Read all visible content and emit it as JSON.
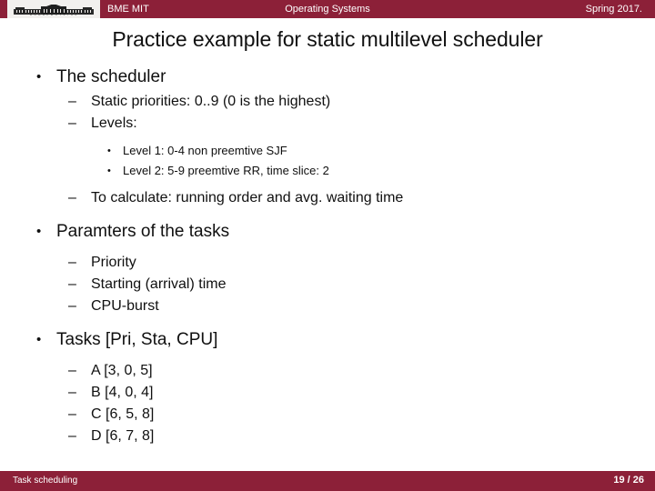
{
  "header": {
    "logo_caption": "B U D A P E S T  1 7 8 2",
    "logo_icon": "bme-building-icon",
    "left_label": "BME MIT",
    "center_label": "Operating Systems",
    "right_label": "Spring 2017."
  },
  "title": "Practice example for static multilevel scheduler",
  "content": {
    "scheduler": {
      "heading": "The scheduler",
      "static_priorities": "Static priorities: 0..9 (0 is the highest)",
      "levels_heading": "Levels:",
      "levels": [
        "Level 1: 0-4 non preemtive SJF",
        "Level 2: 5-9 preemtive RR, time slice: 2"
      ],
      "to_calculate": "To calculate: running order and avg. waiting time"
    },
    "parameters": {
      "heading": "Paramters of the tasks",
      "items": [
        "Priority",
        "Starting (arrival) time",
        "CPU-burst"
      ]
    },
    "tasks": {
      "heading": "Tasks [Pri, Sta, CPU]",
      "items": [
        "A [3, 0, 5]",
        "B [4, 0, 4]",
        "C [6, 5, 8]",
        "D [6, 7, 8]"
      ]
    }
  },
  "footer": {
    "section_label": "Task scheduling",
    "page_label": "19 / 26"
  },
  "colors": {
    "brand_maroon": "#8C2038",
    "text": "#101010",
    "bar_text": "#ffffff"
  }
}
